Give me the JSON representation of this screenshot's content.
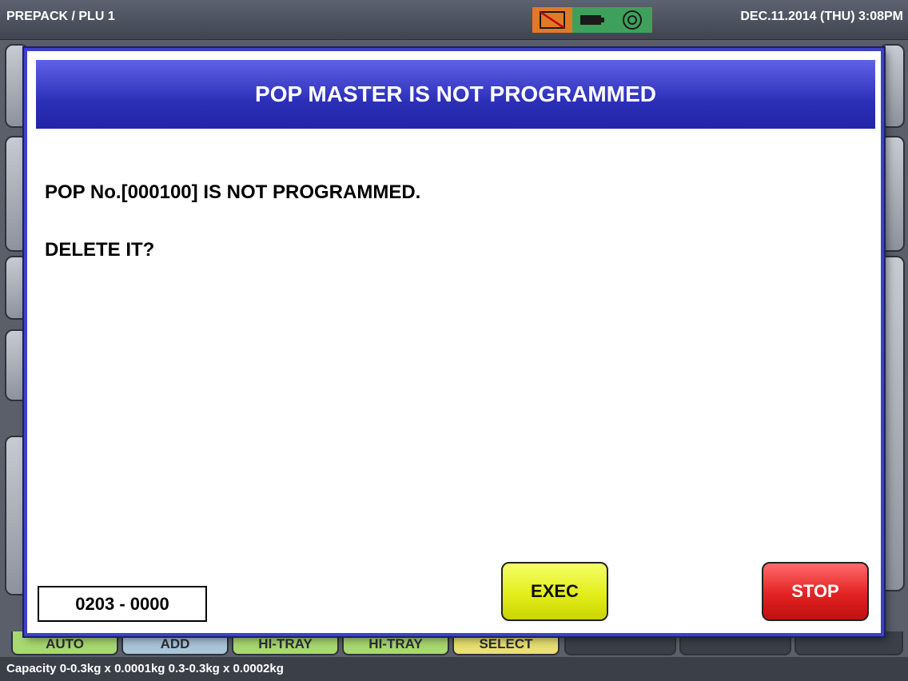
{
  "topbar": {
    "mode": "PREPACK / PLU 1",
    "datetime": "DEC.11.2014 (THU)  3:08PM",
    "icons": [
      "printer-error-icon",
      "battery-icon",
      "network-icon"
    ]
  },
  "dialog": {
    "title": "POP MASTER IS NOT PROGRAMMED",
    "message_1": "POP No.[000100] IS NOT PROGRAMMED.",
    "message_2": "DELETE IT?",
    "code": "0203 - 0000",
    "exec_label": "EXEC",
    "stop_label": "STOP"
  },
  "bottom_tabs": [
    "AUTO",
    "ADD",
    "HI-TRAY",
    "HI-TRAY",
    "SELECT",
    "",
    "",
    ""
  ],
  "capacity_text": "Capacity 0-0.3kg x 0.0001kg  0.3-0.3kg x 0.0002kg",
  "colors": {
    "header": "#2c2fb8",
    "exec": "#e3ee1a",
    "stop": "#e32222"
  }
}
